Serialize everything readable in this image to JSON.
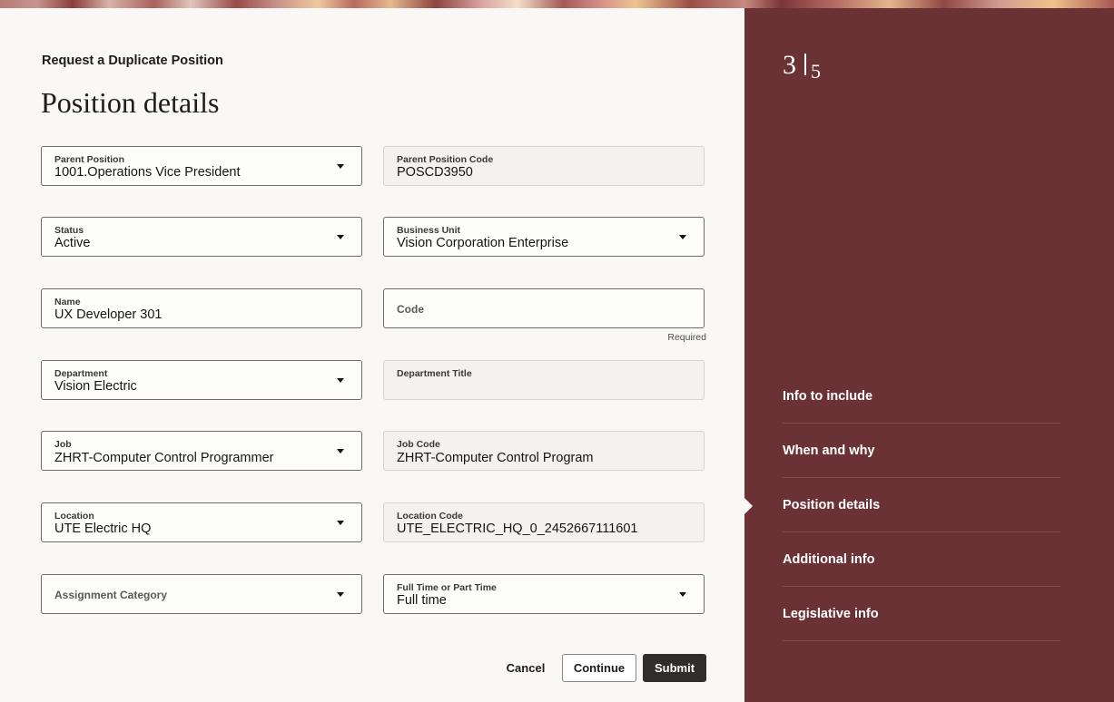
{
  "header": {
    "flow_title": "Request a Duplicate Position",
    "page_title": "Position details"
  },
  "form": {
    "parent_position": {
      "label": "Parent Position",
      "value": "1001.Operations Vice President"
    },
    "parent_position_code": {
      "label": "Parent Position Code",
      "value": "POSCD3950"
    },
    "status": {
      "label": "Status",
      "value": "Active"
    },
    "business_unit": {
      "label": "Business Unit",
      "value": "Vision Corporation Enterprise"
    },
    "name": {
      "label": "Name",
      "value": "UX Developer 301"
    },
    "code": {
      "label": "Code",
      "value": "",
      "helper": "Required"
    },
    "department": {
      "label": "Department",
      "value": "Vision Electric"
    },
    "department_title": {
      "label": "Department Title",
      "value": ""
    },
    "job": {
      "label": "Job",
      "value": " ZHRT-Computer Control Programmer"
    },
    "job_code": {
      "label": "Job Code",
      "value": "ZHRT-Computer Control Program"
    },
    "location": {
      "label": "Location",
      "value": "UTE Electric HQ"
    },
    "location_code": {
      "label": "Location Code",
      "value": "UTE_ELECTRIC_HQ_0_2452667111601"
    },
    "assignment_category": {
      "label": "Assignment Category",
      "value": ""
    },
    "full_part_time": {
      "label": "Full Time or Part Time",
      "value": "Full time"
    }
  },
  "actions": {
    "cancel": "Cancel",
    "continue": "Continue",
    "submit": "Submit"
  },
  "progress": {
    "current_step": "3",
    "total_steps": "5"
  },
  "steps": [
    {
      "label": "Info to include",
      "active": false
    },
    {
      "label": "When and why",
      "active": false
    },
    {
      "label": "Position details",
      "active": true
    },
    {
      "label": "Additional info",
      "active": false
    },
    {
      "label": "Legislative info",
      "active": false
    }
  ],
  "colors": {
    "side_panel": "#6b3235",
    "submit_button": "#312d2a",
    "form_background": "#f9f8f6"
  }
}
